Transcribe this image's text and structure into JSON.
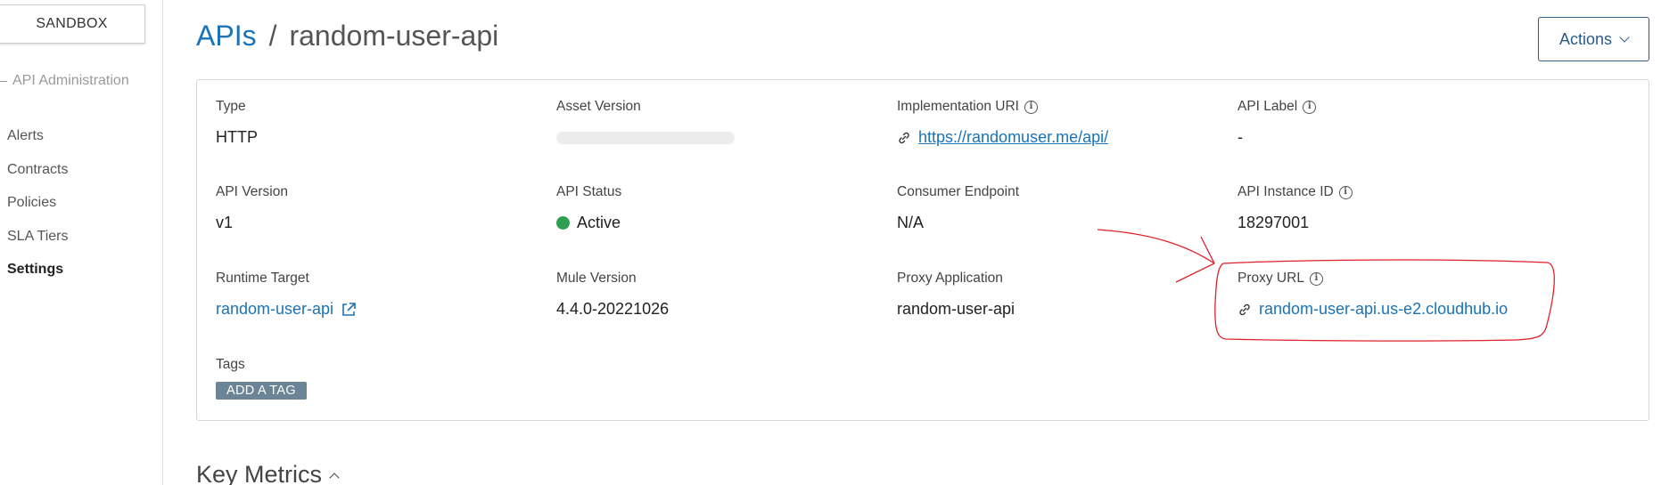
{
  "sidebar": {
    "environment_label": "SANDBOX",
    "section_label": "API Administration",
    "items": [
      {
        "label": "Alerts"
      },
      {
        "label": "Contracts"
      },
      {
        "label": "Policies"
      },
      {
        "label": "SLA Tiers"
      },
      {
        "label": "Settings",
        "active": true
      }
    ]
  },
  "header": {
    "breadcrumb_root": "APIs",
    "breadcrumb_separator": "/",
    "breadcrumb_current": "random-user-api",
    "actions_label": "Actions"
  },
  "details": {
    "type": {
      "label": "Type",
      "value": "HTTP"
    },
    "asset_version": {
      "label": "Asset Version",
      "value": ""
    },
    "implementation_uri": {
      "label": "Implementation URI",
      "value": "https://randomuser.me/api/",
      "icon": "info-icon"
    },
    "api_label": {
      "label": "API Label",
      "value": "-",
      "icon": "info-icon"
    },
    "api_version": {
      "label": "API Version",
      "value": "v1"
    },
    "api_status": {
      "label": "API Status",
      "value": "Active",
      "status_color": "#2e9e4f"
    },
    "consumer_endpoint": {
      "label": "Consumer Endpoint",
      "value": "N/A"
    },
    "api_instance_id": {
      "label": "API Instance ID",
      "value": "18297001",
      "icon": "info-icon"
    },
    "runtime_target": {
      "label": "Runtime Target",
      "value": "random-user-api",
      "icon": "external-link-icon"
    },
    "mule_version": {
      "label": "Mule Version",
      "value": "4.4.0-20221026"
    },
    "proxy_application": {
      "label": "Proxy Application",
      "value": "random-user-api"
    },
    "proxy_url": {
      "label": "Proxy URL",
      "value": "random-user-api.us-e2.cloudhub.io",
      "icon": "info-icon"
    },
    "tags": {
      "label": "Tags",
      "add_button_label": "ADD A TAG"
    }
  },
  "key_metrics": {
    "title": "Key Metrics"
  },
  "colors": {
    "link": "#1a73b8",
    "actions_border": "#2c5c8a",
    "tag_button": "#6b8496",
    "annotation": "#e0202a"
  }
}
